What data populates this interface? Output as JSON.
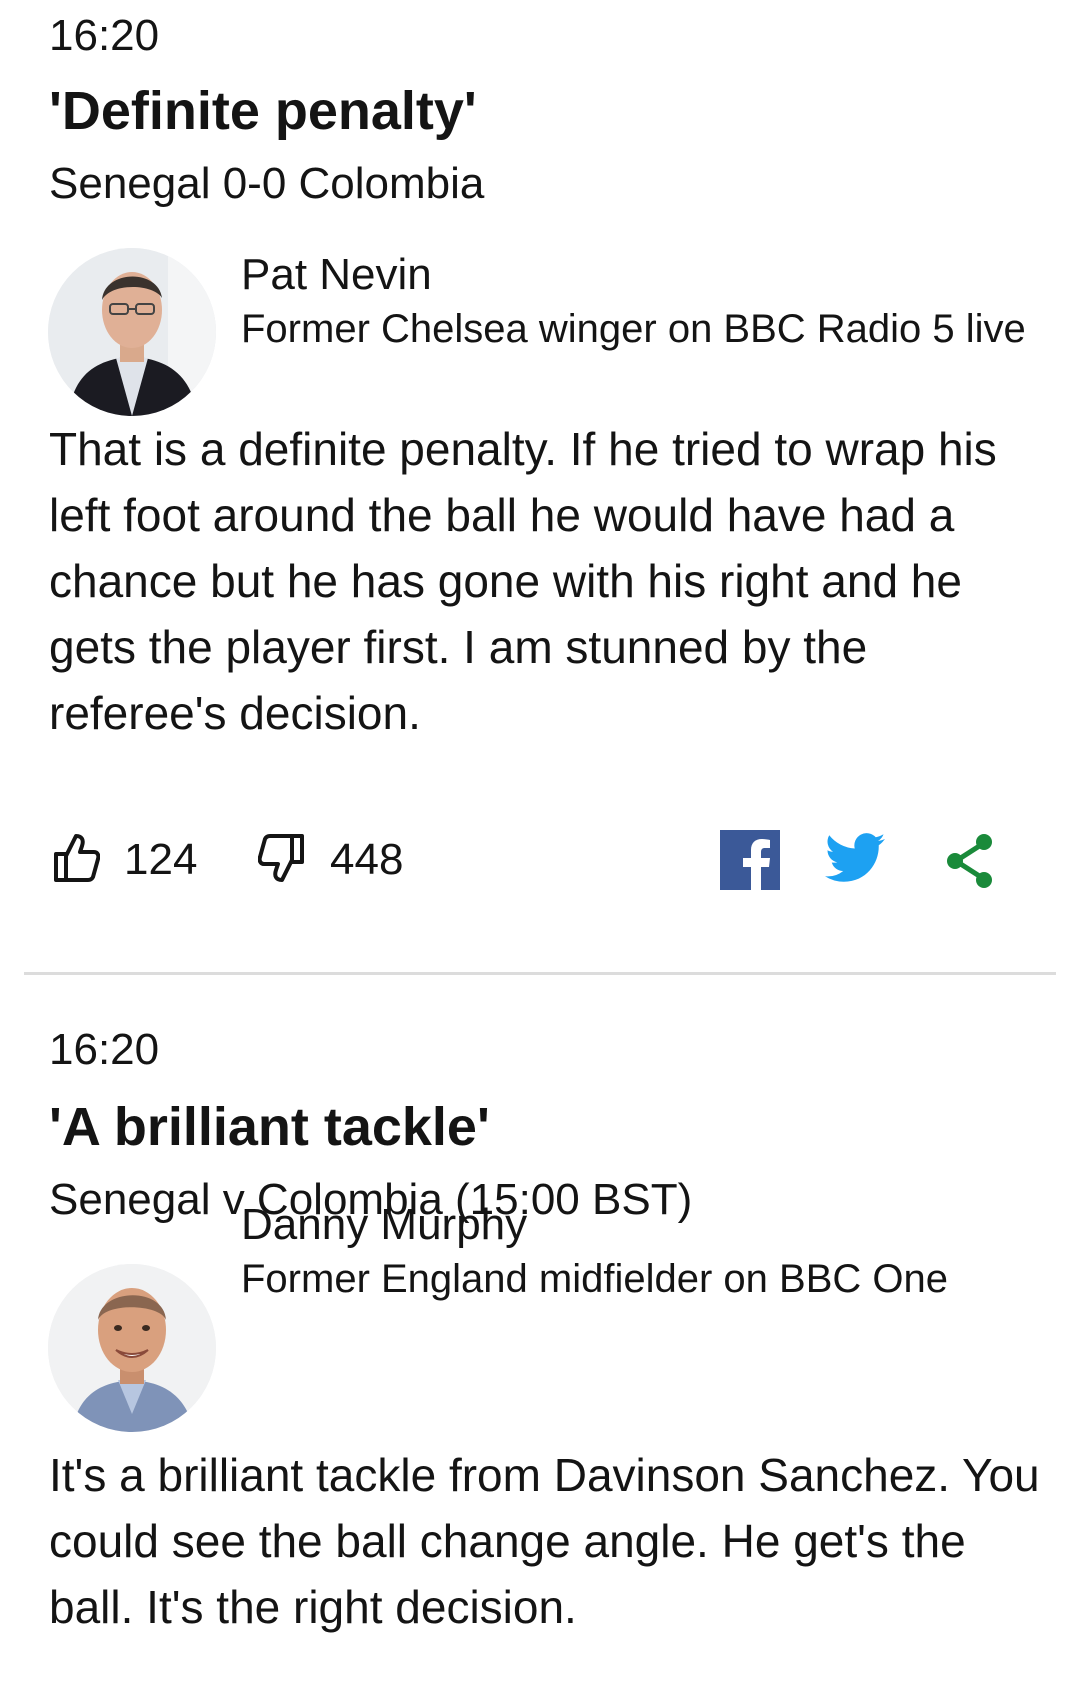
{
  "posts": [
    {
      "time": "16:20",
      "title": "'Definite penalty'",
      "match": "Senegal 0-0 Colombia",
      "author": {
        "name": "Pat Nevin",
        "role": "Former Chelsea winger on BBC Radio 5 live",
        "avatar_icon": "person-photo"
      },
      "body": "That is a definite penalty. If he tried to wrap his left foot around the ball he would have had a chance but he has gone with his right and he gets the player first. I am stunned by the referee's decision.",
      "reactions": {
        "likes": "124",
        "dislikes": "448",
        "like_icon": "thumbs-up-icon",
        "dislike_icon": "thumbs-down-icon"
      },
      "share": {
        "facebook_icon": "facebook-icon",
        "twitter_icon": "twitter-icon",
        "share_icon": "share-icon"
      }
    },
    {
      "time": "16:20",
      "title": "'A brilliant tackle'",
      "match": "Senegal v Colombia (15:00 BST)",
      "author": {
        "name": "Danny Murphy",
        "role": "Former England midfielder on BBC One",
        "avatar_icon": "person-photo"
      },
      "body": "It's a brilliant tackle from Davinson Sanchez. You could see the ball change angle. He get's the ball. It's the right decision."
    }
  ],
  "colors": {
    "text": "#141414",
    "facebook": "#3b5998",
    "twitter": "#1da1f2",
    "share": "#1a8a3a",
    "divider": "#dcdcdc"
  }
}
